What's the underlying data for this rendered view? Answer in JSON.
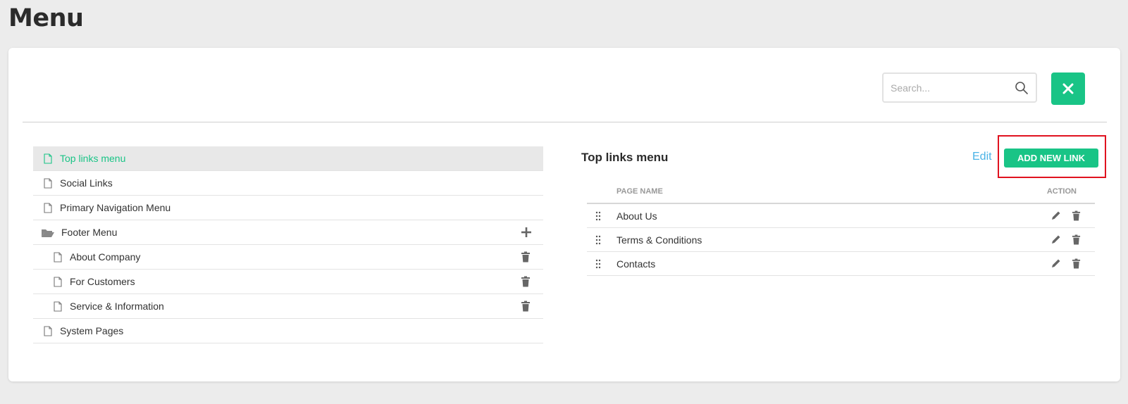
{
  "page": {
    "title": "Menu"
  },
  "toolbar": {
    "search_placeholder": "Search..."
  },
  "tree": {
    "items": [
      {
        "label": "Top links menu",
        "active": true
      },
      {
        "label": "Social Links"
      },
      {
        "label": "Primary Navigation Menu"
      },
      {
        "label": "Footer Menu",
        "folder": true
      },
      {
        "label": "About Company",
        "child": true
      },
      {
        "label": "For Customers",
        "child": true
      },
      {
        "label": "Service & Information",
        "child": true
      },
      {
        "label": "System Pages"
      }
    ]
  },
  "panel": {
    "title": "Top links menu",
    "edit_label": "Edit",
    "add_label": "ADD NEW LINK",
    "columns": {
      "name": "PAGE NAME",
      "action": "ACTION"
    },
    "links": [
      {
        "name": "About Us"
      },
      {
        "name": "Terms & Conditions"
      },
      {
        "name": "Contacts"
      }
    ]
  },
  "colors": {
    "accent": "#19c486",
    "link": "#4ab3e6",
    "highlight": "#e0121f"
  }
}
